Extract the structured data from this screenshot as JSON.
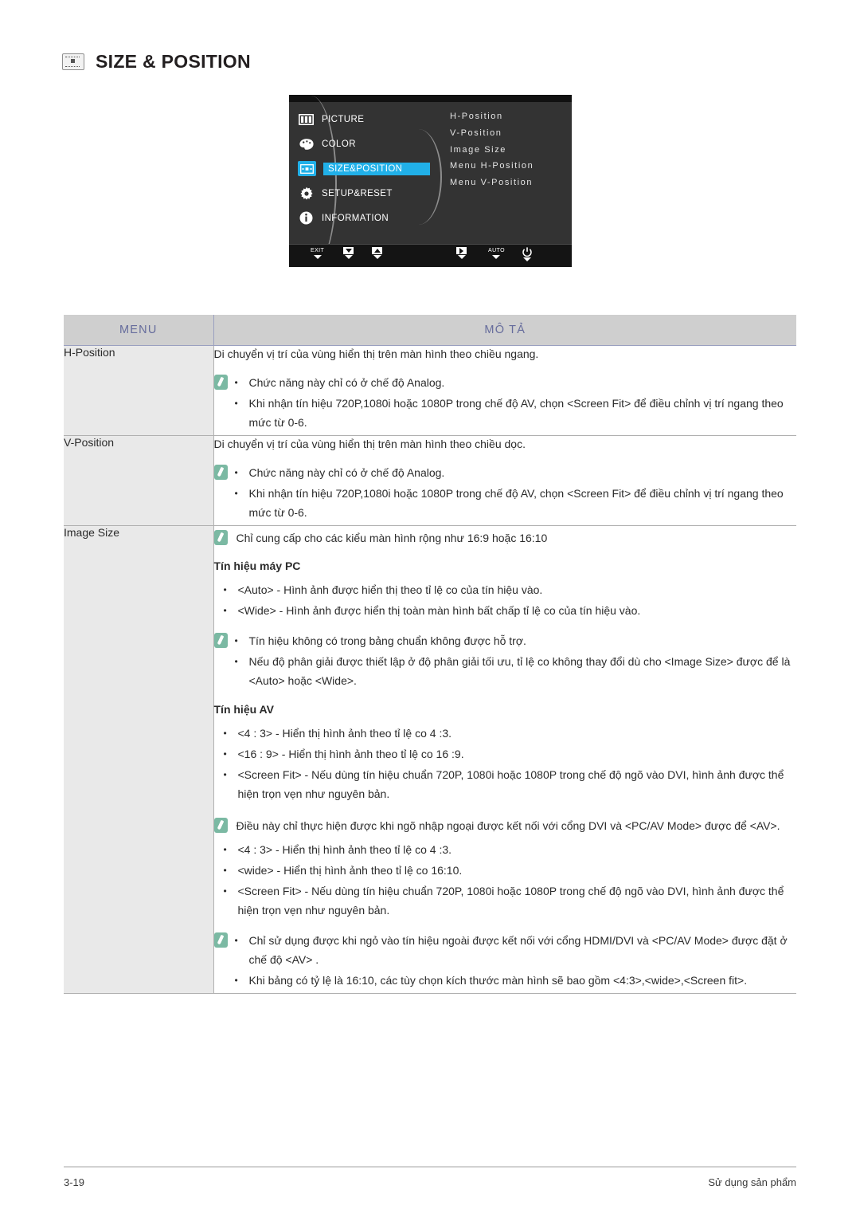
{
  "page": {
    "title": "SIZE & POSITION",
    "title_icon": "size-position-icon",
    "footer_page_number": "3-19",
    "footer_section": "Sử dụng sản phẩm"
  },
  "osd": {
    "left_menu": [
      {
        "label": "PICTURE",
        "icon": "picture-icon",
        "selected": false
      },
      {
        "label": "COLOR",
        "icon": "color-icon",
        "selected": false
      },
      {
        "label": "SIZE&POSITION",
        "icon": "size-position-icon",
        "selected": true
      },
      {
        "label": "SETUP&RESET",
        "icon": "gear-icon",
        "selected": false
      },
      {
        "label": "INFORMATION",
        "icon": "info-icon",
        "selected": false
      }
    ],
    "right_menu": [
      "H-Position",
      "V-Position",
      "Image Size",
      "Menu H-Position",
      "Menu V-Position"
    ],
    "buttons": [
      {
        "label": "EXIT",
        "icon": "exit-label"
      },
      {
        "label": "",
        "icon": "down-arrow-icon"
      },
      {
        "label": "",
        "icon": "up-arrow-icon"
      },
      {
        "label": "",
        "icon": "enter-icon"
      },
      {
        "label": "AUTO",
        "icon": "auto-label"
      },
      {
        "label": "",
        "icon": "power-icon"
      }
    ],
    "highlight_color": "#21b0e8",
    "background_color": "#333333"
  },
  "table": {
    "header": {
      "menu": "MENU",
      "description": "MÔ TẢ",
      "header_bg": "#cfcfcf",
      "header_text_color": "#666c9c"
    },
    "rows": [
      {
        "menu": "H-Position",
        "lead": "Di chuyển vị trí của vùng hiển thị trên màn hình theo chiều ngang.",
        "note_bullets": [
          "Chức năng này chỉ có ở chế độ Analog.",
          "Khi nhận tín hiệu 720P,1080i hoặc 1080P trong chế độ AV, chọn <Screen Fit> để điều chỉnh vị trí ngang theo mức từ 0-6."
        ]
      },
      {
        "menu": "V-Position",
        "lead": "Di chuyển vị trí của vùng hiển thị trên màn hình theo chiều dọc.",
        "note_bullets": [
          "Chức năng này chỉ có ở chế độ Analog.",
          "Khi nhận tín hiệu 720P,1080i hoặc 1080P trong chế độ AV, chọn <Screen Fit> để điều chỉnh vị trí ngang theo mức từ 0-6."
        ]
      },
      {
        "menu": "Image Size",
        "note_plain": "Chỉ cung cấp cho các kiểu màn hình rộng như 16:9 hoặc 16:10",
        "pc_heading": "Tín hiệu máy PC",
        "pc_bullets": [
          "<Auto> - Hình ảnh được hiển thị theo tỉ lệ co của tín hiệu vào.",
          "<Wide> - Hình ảnh được hiển thị toàn màn hình bất chấp tỉ lệ co của tín hiệu vào."
        ],
        "pc_note_bullets": [
          "Tín hiệu không có trong bảng chuẩn không được hỗ trợ.",
          "Nếu độ phân giải được thiết lập ở độ phân giải tối ưu, tỉ lệ co không thay đổi dù cho <Image Size> được để là <Auto> hoặc <Wide>."
        ],
        "av_heading": "Tín hiệu AV",
        "av_bullets_1": [
          "<4 : 3> - Hiển thị hình ảnh theo tỉ lệ co 4 :3.",
          "<16 : 9> - Hiển thị hình ảnh theo tỉ lệ co 16 :9.",
          "<Screen Fit> - Nếu dùng tín hiệu chuẩn 720P, 1080i hoặc 1080P trong chế độ ngõ vào DVI, hình ảnh được thể hiện trọn vẹn như nguyên bản."
        ],
        "av_note_1": "Điều này chỉ thực hiện được khi ngõ nhập ngoại được kết nối với cổng DVI và <PC/AV Mode> được để <AV>.",
        "av_bullets_2": [
          "<4 : 3> - Hiển thị hình ảnh theo tỉ lệ co 4 :3.",
          "<wide> - Hiển thị hình ảnh theo tỉ lệ co 16:10.",
          "<Screen Fit> - Nếu dùng tín hiệu chuẩn 720P, 1080i hoặc 1080P trong chế độ ngõ vào DVI, hình ảnh được thể hiện trọn vẹn như nguyên bản."
        ],
        "av_note_bullets_2": [
          "Chỉ sử dụng được khi ngỏ vào tín hiệu ngoài được kết nối với cổng HDMI/DVI và <PC/AV Mode> được đặt ở chế độ <AV> .",
          "Khi bảng có tỷ lệ là 16:10, các tùy chọn kích thước màn hình sẽ bao gồm <4:3>,<wide>,<Screen fit>."
        ]
      }
    ]
  }
}
